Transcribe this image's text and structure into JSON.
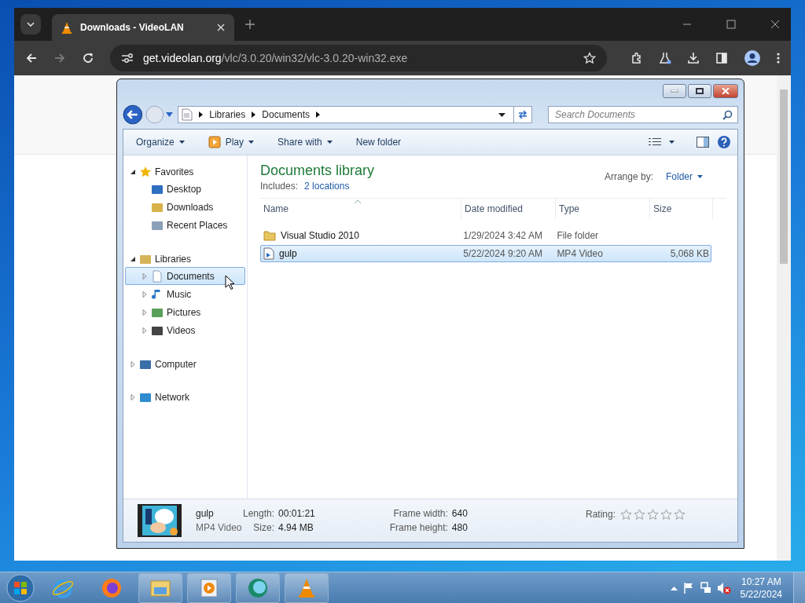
{
  "browser": {
    "tab": {
      "title": "Downloads - VideoLAN",
      "selected": true
    },
    "address": {
      "host": "get.videolan.org",
      "path": "/vlc/3.0.20/win32/vlc-3.0.20-win32.exe"
    }
  },
  "explorer": {
    "breadcrumb": [
      "Libraries",
      "Documents"
    ],
    "search": {
      "placeholder": "Search Documents"
    },
    "toolbar": [
      {
        "label": "Organize",
        "kind": "menu"
      },
      {
        "label": "Play",
        "kind": "play"
      },
      {
        "label": "Share with",
        "kind": "menu"
      },
      {
        "label": "New folder",
        "kind": "plain"
      }
    ],
    "nav": [
      {
        "label": "Favorites",
        "expanded": true,
        "children": [
          {
            "label": "Desktop",
            "selected": false
          },
          {
            "label": "Downloads",
            "selected": false
          },
          {
            "label": "Recent Places",
            "selected": false
          }
        ]
      },
      {
        "label": "Libraries",
        "expanded": true,
        "children": [
          {
            "label": "Documents",
            "selected": true,
            "expanded": false
          },
          {
            "label": "Music",
            "selected": false,
            "expanded": false
          },
          {
            "label": "Pictures",
            "selected": false,
            "expanded": false
          },
          {
            "label": "Videos",
            "selected": false,
            "expanded": false
          }
        ]
      },
      {
        "label": "Computer",
        "expanded": false
      },
      {
        "label": "Network",
        "expanded": false
      }
    ],
    "library": {
      "title": "Documents library",
      "includes_label": "Includes:",
      "locations": "2 locations",
      "arrange_label": "Arrange by:",
      "arrange_value": "Folder"
    },
    "columns": [
      "Name",
      "Date modified",
      "Type",
      "Size"
    ],
    "files": [
      {
        "name": "Visual Studio 2010",
        "date": "1/29/2024 3:42 AM",
        "type": "File folder",
        "kind": "folder",
        "selected": false
      },
      {
        "name": "gulp",
        "date": "5/22/2024 9:20 AM",
        "type": "MP4 Video",
        "size": "5,068 KB",
        "kind": "video",
        "selected": true
      }
    ],
    "details": {
      "name": "gulp",
      "type": "MP4 Video",
      "fields": [
        {
          "label": "Length:",
          "value": "00:01:21"
        },
        {
          "label": "Size:",
          "value": "4.94 MB"
        },
        {
          "label": "Frame width:",
          "value": "640"
        },
        {
          "label": "Frame height:",
          "value": "480"
        }
      ],
      "rating_label": "Rating:",
      "stars": 0
    }
  },
  "taskbar": {
    "apps": [
      {
        "kind": "ie",
        "running": false
      },
      {
        "kind": "firefox",
        "running": false
      },
      {
        "kind": "explorer",
        "running": true
      },
      {
        "kind": "media",
        "running": true
      },
      {
        "kind": "chat",
        "running": true
      },
      {
        "kind": "vlc",
        "running": true
      }
    ],
    "clock": {
      "time": "10:27 AM",
      "date": "5/22/2024"
    }
  }
}
